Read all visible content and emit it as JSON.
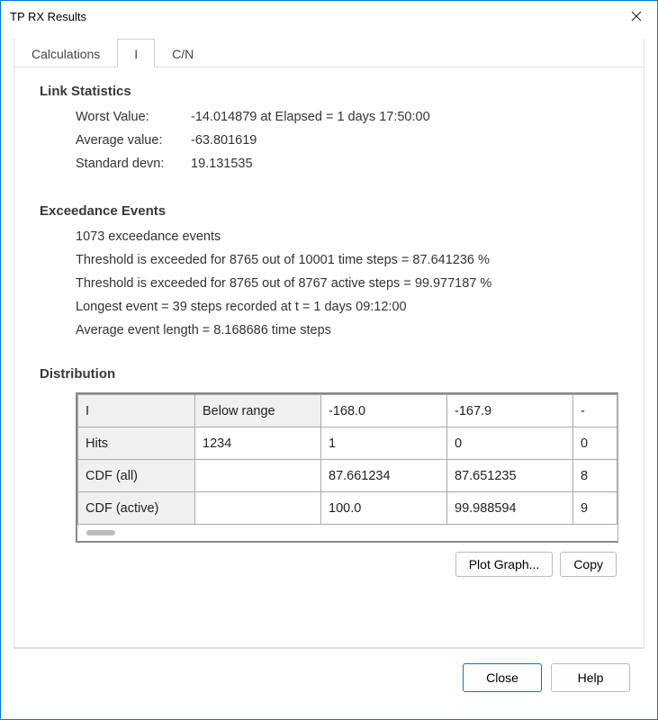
{
  "window": {
    "title": "TP RX Results"
  },
  "tabs": [
    {
      "label": "Calculations"
    },
    {
      "label": "I"
    },
    {
      "label": "C/N"
    }
  ],
  "stats": {
    "title": "Link Statistics",
    "worst_label": "Worst Value:",
    "worst_value": "-14.014879 at Elapsed = 1 days 17:50:00",
    "avg_label": "Average value:",
    "avg_value": "-63.801619",
    "std_label": "Standard devn:",
    "std_value": "19.131535"
  },
  "events": {
    "title": "Exceedance Events",
    "line1": "1073 exceedance events",
    "line2": "Threshold is exceeded for 8765 out of 10001 time steps =  87.641236 %",
    "line3": "Threshold is exceeded for 8765 out of 8767 active steps =  99.977187 %",
    "line4": "Longest event = 39 steps recorded at t = 1 days 09:12:00",
    "line5": "Average event length = 8.168686 time steps"
  },
  "distribution": {
    "title": "Distribution",
    "row_headers": [
      "I",
      "Hits",
      "CDF (all)",
      "CDF (active)"
    ],
    "cols": [
      {
        "I": "Below range",
        "Hits": "1234",
        "CDFall": "",
        "CDFactive": ""
      },
      {
        "I": "-168.0",
        "Hits": "1",
        "CDFall": "87.661234",
        "CDFactive": "100.0"
      },
      {
        "I": "-167.9",
        "Hits": "0",
        "CDFall": "87.651235",
        "CDFactive": "99.988594"
      },
      {
        "I": "-",
        "Hits": "0",
        "CDFall": "8",
        "CDFactive": "9"
      }
    ],
    "plot_button": "Plot Graph...",
    "copy_button": "Copy"
  },
  "footer": {
    "close": "Close",
    "help": "Help"
  }
}
